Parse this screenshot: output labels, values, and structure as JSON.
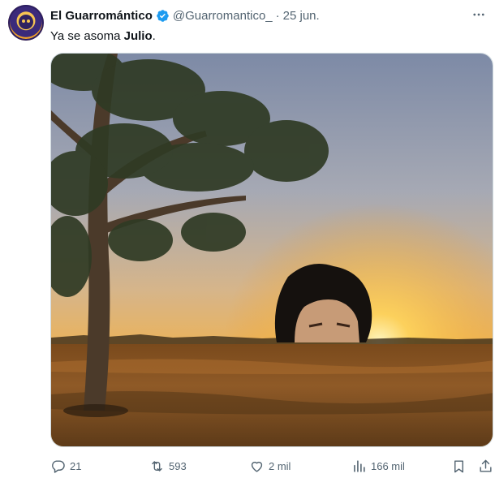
{
  "tweet": {
    "author_name": "El Guarromántico",
    "handle": "@Guarromantico_",
    "separator": "·",
    "date": "25 jun.",
    "text_prefix": "Ya se asoma ",
    "text_bold": "Julio",
    "text_suffix": ".",
    "verified": true
  },
  "metrics": {
    "replies": "21",
    "retweets": "593",
    "likes": "2 mil",
    "views": "166 mil"
  },
  "icons": {
    "verified": "verified-badge-icon",
    "more": "more-icon",
    "reply": "reply-icon",
    "retweet": "retweet-icon",
    "like": "heart-icon",
    "views": "views-chart-icon",
    "bookmark": "bookmark-icon",
    "share": "share-icon"
  },
  "colors": {
    "verified_blue": "#1d9bf0",
    "secondary_text": "#536471",
    "primary_text": "#0f1419"
  }
}
